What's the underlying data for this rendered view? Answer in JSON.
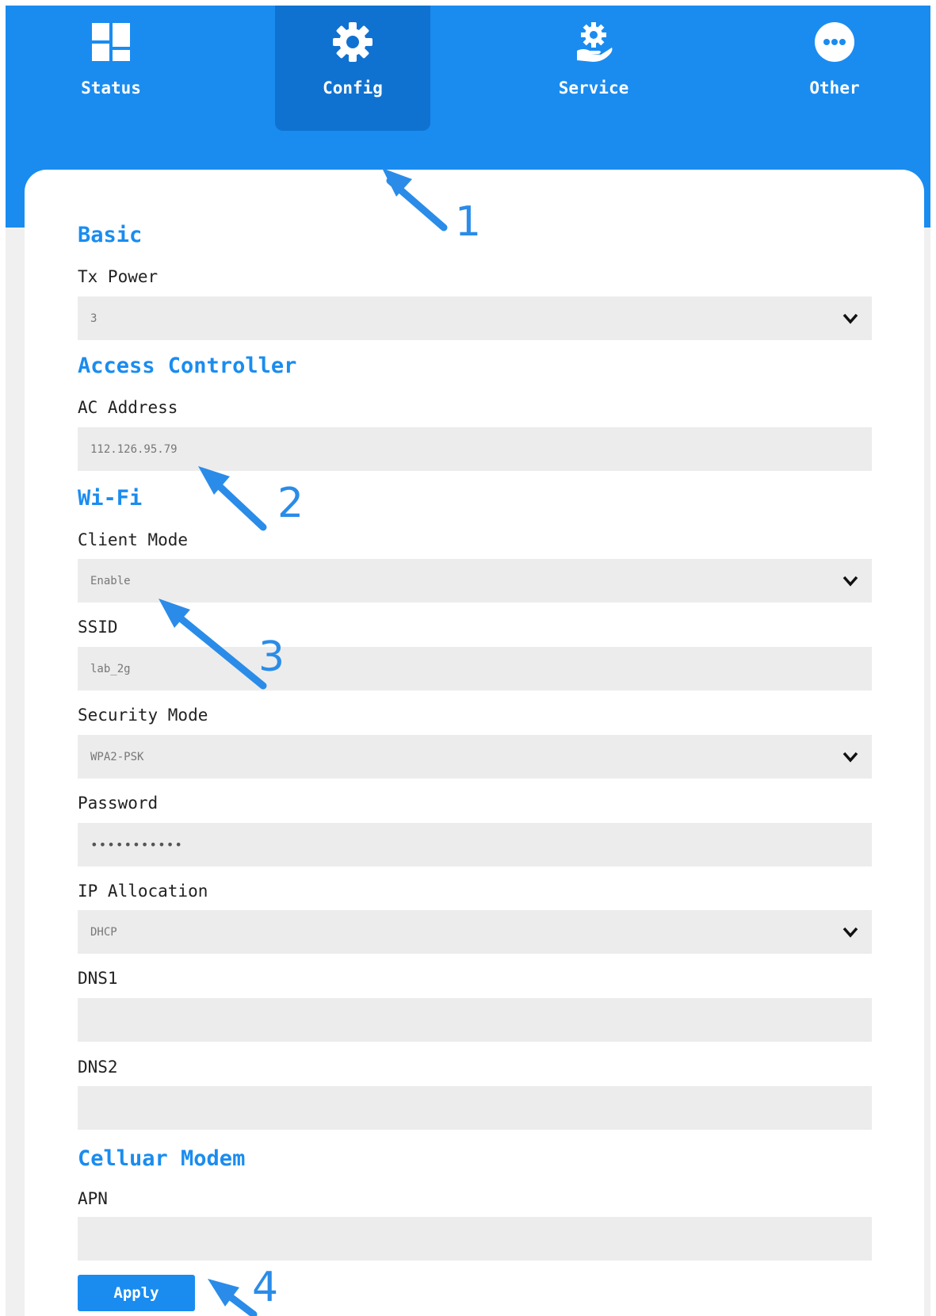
{
  "nav": {
    "tabs": [
      {
        "label": "Status",
        "icon": "dashboard-icon",
        "active": false
      },
      {
        "label": "Config",
        "icon": "gear-icon",
        "active": true
      },
      {
        "label": "Service",
        "icon": "service-icon",
        "active": false
      },
      {
        "label": "Other",
        "icon": "more-icon",
        "active": false
      }
    ]
  },
  "sections": {
    "basic": {
      "title": "Basic"
    },
    "ac": {
      "title": "Access Controller"
    },
    "wifi": {
      "title": "Wi-Fi"
    },
    "modem": {
      "title": "Celluar Modem"
    }
  },
  "fields": {
    "tx_power": {
      "label": "Tx Power",
      "value": "3"
    },
    "ac_address": {
      "label": "AC Address",
      "value": "112.126.95.79"
    },
    "client_mode": {
      "label": "Client Mode",
      "value": "Enable"
    },
    "ssid": {
      "label": "SSID",
      "value": "lab_2g"
    },
    "security_mode": {
      "label": "Security Mode",
      "value": "WPA2-PSK"
    },
    "password": {
      "label": "Password",
      "value": "•••••••••••"
    },
    "ip_allocation": {
      "label": "IP Allocation",
      "value": "DHCP"
    },
    "dns1": {
      "label": "DNS1",
      "value": ""
    },
    "dns2": {
      "label": "DNS2",
      "value": ""
    },
    "apn": {
      "label": "APN",
      "value": ""
    }
  },
  "actions": {
    "apply_label": "Apply"
  },
  "callouts": [
    "1",
    "2",
    "3",
    "4"
  ],
  "colors": {
    "accent": "#1a8cf0",
    "accent_dark": "#0f72d1",
    "field_bg": "#ececec",
    "callout": "#2a8ce8"
  }
}
